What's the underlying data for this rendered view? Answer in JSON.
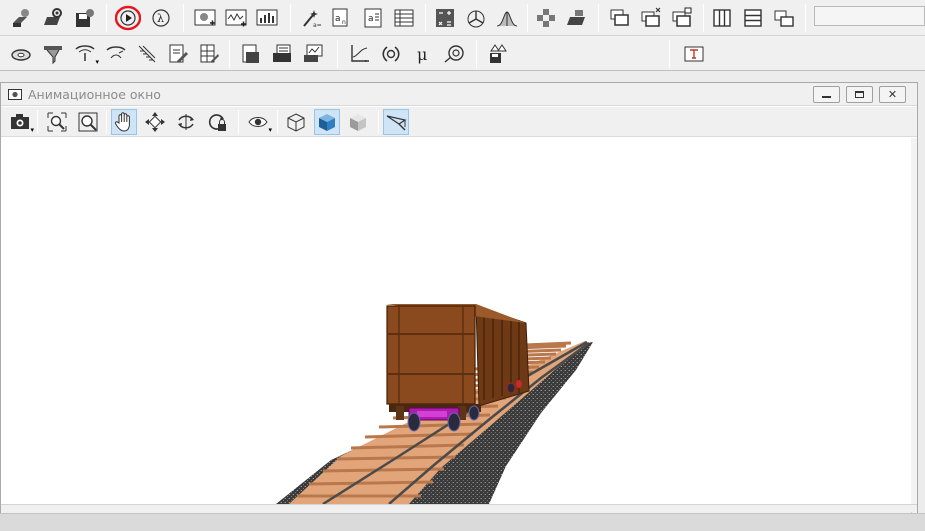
{
  "main_toolbar_row1": {
    "buttons": [
      {
        "name": "new-model-button",
        "icon": "new-model-icon"
      },
      {
        "name": "open-model-button",
        "icon": "open-settings-icon"
      },
      {
        "name": "save-model-button",
        "icon": "save-icon"
      },
      {
        "name": "run-simulation-button",
        "icon": "play-icon",
        "highlighted": true
      },
      {
        "name": "lambda-button",
        "icon": "lambda-icon"
      },
      {
        "name": "animation-window-button",
        "icon": "animation-window-icon"
      },
      {
        "name": "graph-window-button",
        "icon": "graph-window-icon"
      },
      {
        "name": "bar-chart-window-button",
        "icon": "bar-chart-icon"
      },
      {
        "name": "wizard-button",
        "icon": "wizard-icon"
      },
      {
        "name": "variable-a-button",
        "icon": "variable-a-icon"
      },
      {
        "name": "document-a-button",
        "icon": "document-a-icon"
      },
      {
        "name": "table-button",
        "icon": "table-icon"
      },
      {
        "name": "calculator-button",
        "icon": "calculator-icon"
      },
      {
        "name": "axes-button",
        "icon": "axes-icon"
      },
      {
        "name": "distribution-button",
        "icon": "distribution-icon"
      },
      {
        "name": "arrange-button",
        "icon": "arrange-icon"
      },
      {
        "name": "export-button",
        "icon": "export-folder-icon"
      },
      {
        "name": "cascade-windows-button",
        "icon": "cascade-icon"
      },
      {
        "name": "close-windows-button",
        "icon": "close-windows-icon"
      },
      {
        "name": "restore-windows-button",
        "icon": "restore-windows-icon"
      },
      {
        "name": "tile-vertical-button",
        "icon": "tile-vertical-icon"
      },
      {
        "name": "tile-horizontal-button",
        "icon": "tile-horizontal-icon"
      },
      {
        "name": "minimize-all-button",
        "icon": "minimize-all-icon"
      }
    ]
  },
  "main_toolbar_row2": {
    "buttons": [
      {
        "name": "ellipsoid-button",
        "icon": "ellipsoid-icon"
      },
      {
        "name": "filter-button",
        "icon": "filter-icon"
      },
      {
        "name": "joint-button",
        "icon": "joint-icon"
      },
      {
        "name": "force-button",
        "icon": "force-icon"
      },
      {
        "name": "rail-button",
        "icon": "rail-icon"
      },
      {
        "name": "edit-document-button",
        "icon": "edit-document-icon"
      },
      {
        "name": "edit-grid-button",
        "icon": "edit-grid-icon"
      },
      {
        "name": "report-button",
        "icon": "report-icon"
      },
      {
        "name": "print-button",
        "icon": "print-icon"
      },
      {
        "name": "chart-report-button",
        "icon": "chart-report-icon"
      },
      {
        "name": "graph-axes-button",
        "icon": "graph-axes-icon"
      },
      {
        "name": "frequency-button",
        "icon": "frequency-icon"
      },
      {
        "name": "mu-button",
        "icon": "mu-icon"
      },
      {
        "name": "target-button",
        "icon": "target-icon"
      },
      {
        "name": "save-tree-button",
        "icon": "save-tree-icon"
      },
      {
        "name": "text-button",
        "icon": "text-icon"
      }
    ]
  },
  "animation_window": {
    "title": "Анимационное окно",
    "controls": {
      "minimize": "minimize-icon",
      "restore": "restore-icon",
      "close": "close-icon"
    },
    "toolbar": [
      {
        "name": "camera-button",
        "icon": "camera-icon"
      },
      {
        "name": "zoom-in-button",
        "icon": "zoom-icon"
      },
      {
        "name": "zoom-fit-button",
        "icon": "zoom-fit-icon"
      },
      {
        "name": "pan-button",
        "icon": "hand-icon",
        "active": true
      },
      {
        "name": "move-button",
        "icon": "move-icon"
      },
      {
        "name": "rotate-button",
        "icon": "rotate-icon"
      },
      {
        "name": "rotate-lock-button",
        "icon": "rotate-lock-icon"
      },
      {
        "name": "view-button",
        "icon": "eye-icon"
      },
      {
        "name": "wireframe-button",
        "icon": "wireframe-cube-icon"
      },
      {
        "name": "solid-button",
        "icon": "solid-cube-icon",
        "active": true
      },
      {
        "name": "shaded-button",
        "icon": "shaded-cube-icon"
      },
      {
        "name": "perspective-button",
        "icon": "perspective-icon",
        "active": true
      }
    ]
  },
  "colors": {
    "accent_highlight": "#e8141c",
    "wagon_body": "#8b4a1e",
    "wagon_body_dark": "#5e2f10",
    "rail_bed": "#e2a57a",
    "ballast": "#2e2e2e",
    "bogie_purple": "#b01ab0",
    "active_button": "#cfe5f7"
  }
}
